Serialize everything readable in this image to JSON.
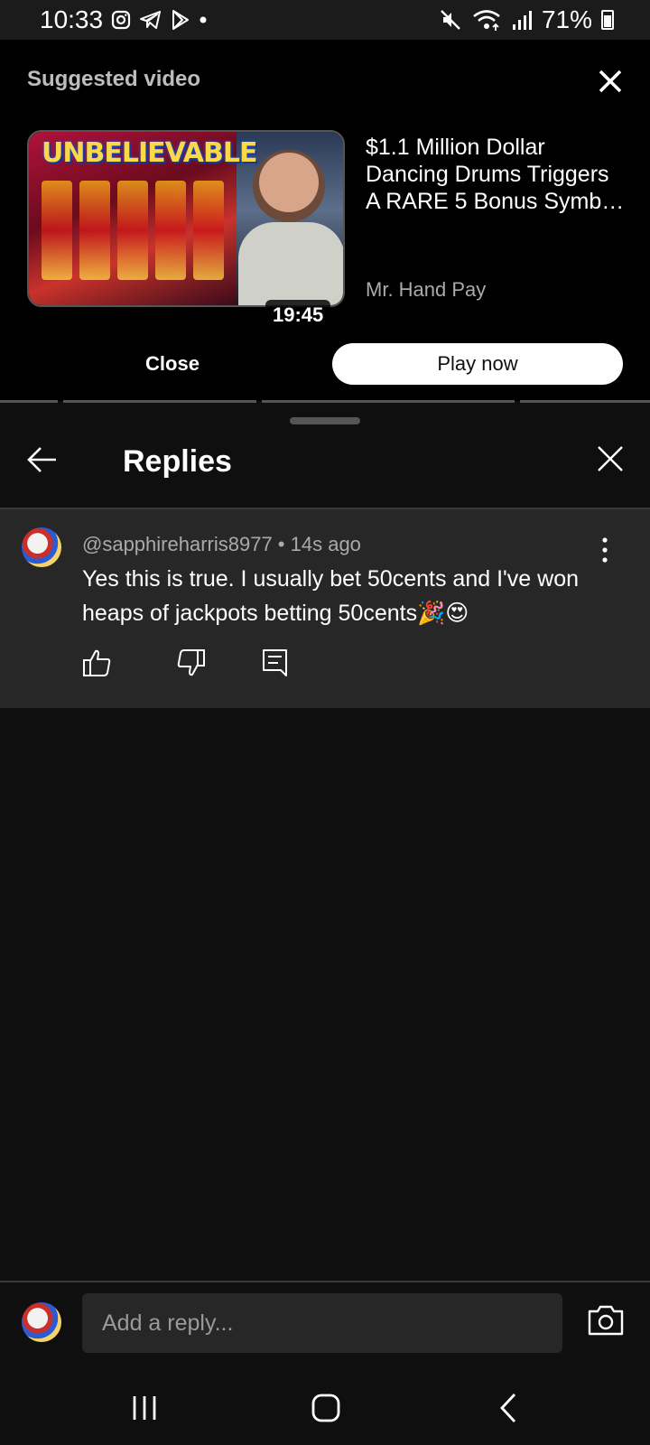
{
  "status_bar": {
    "time": "10:33",
    "battery_pct": "71%",
    "left_icons": [
      "instagram-icon",
      "telegram-icon",
      "play-store-icon",
      "dot-icon"
    ],
    "right_icons": [
      "mute-icon",
      "wifi-icon",
      "signal-icon",
      "battery-icon"
    ]
  },
  "suggested": {
    "heading": "Suggested video",
    "thumbnail_text": "UNBELIEVABLE",
    "duration": "19:45",
    "title": "$1.1 Million Dollar Dancing Drums Triggers A RARE 5 Bonus Symb…",
    "channel": "Mr. Hand Pay",
    "close_label": "Close",
    "play_label": "Play now"
  },
  "replies": {
    "title": "Replies",
    "comment": {
      "author": "@sapphireharris8977",
      "separator": " • ",
      "time": "14s ago",
      "text": "Yes this is true. I usually bet 50cents and I've won heaps of jackpots betting 50cents🎉😍"
    }
  },
  "reply_bar": {
    "placeholder": "Add a reply..."
  },
  "colors": {
    "background": "#0f0f0f",
    "comment_bg": "#272727",
    "play_button": "#ffffff",
    "muted_text": "#aaaaaa"
  }
}
